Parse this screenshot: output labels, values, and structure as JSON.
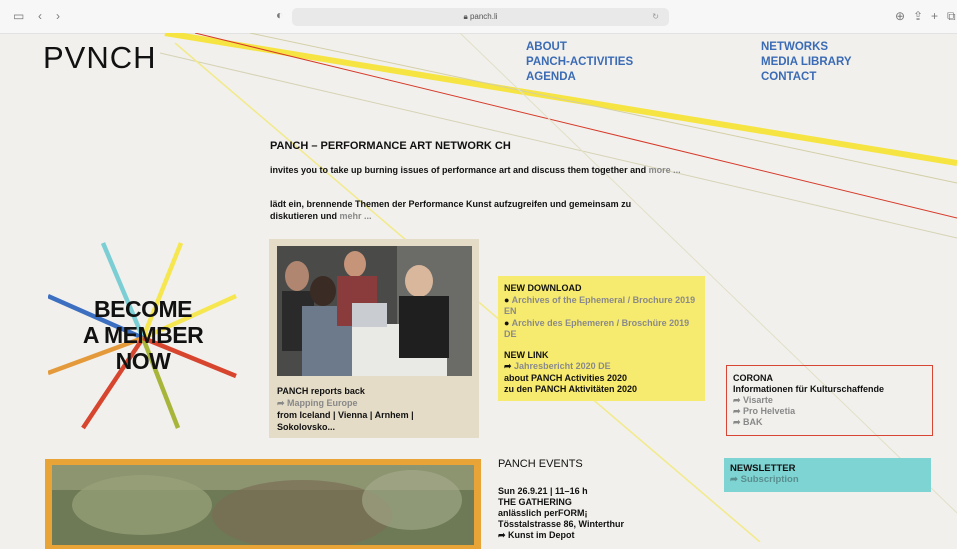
{
  "browser": {
    "url": "panch.li",
    "sidebar_icon": "sidebar-icon",
    "back": "‹",
    "forward": "›",
    "privacy_icon": "shield-icon",
    "right_icons": [
      "download-icon",
      "share-icon",
      "plus-icon",
      "tabs-icon"
    ]
  },
  "logo": "PVNCH",
  "nav": {
    "col1": [
      "ABOUT",
      "PANCH-ACTIVITIES",
      "AGENDA"
    ],
    "col2": [
      "NETWORKS",
      "MEDIA LIBRARY",
      "CONTACT"
    ]
  },
  "intro": {
    "title": "PANCH – PERFORMANCE ART NETWORK CH",
    "en_text": "invites you to take up burning issues of performance art and discuss them together and ",
    "en_more": "more ...",
    "de_text": "lädt ein, brennende Themen der Performance Kunst aufzugreifen und gemeinsam zu diskutieren und ",
    "de_more": "mehr ..."
  },
  "member": {
    "line1": "BECOME",
    "line2": "A MEMBER",
    "line3": "NOW"
  },
  "report": {
    "title": "PANCH reports back",
    "link": "Mapping Europe",
    "text": "from Iceland | Vienna | Arnhem | Sokolovsko..."
  },
  "download": {
    "title": "NEW DOWNLOAD",
    "item1": "Archives of the Ephemeral / Brochure 2019 EN",
    "item2": "Archive des Ephemeren / Broschüre 2019 DE",
    "link_title": "NEW LINK",
    "link": "Jahresbericht 2020 DE",
    "about1": "about PANCH Activities 2020",
    "about2": "zu den PANCH Aktivitäten 2020"
  },
  "corona": {
    "title": "CORONA",
    "subtitle": "Informationen für Kulturschaffende",
    "links": [
      "Visarte",
      "Pro Helvetia",
      "BAK"
    ]
  },
  "events": {
    "title": "PANCH EVENTS",
    "date": "Sun 26.9.21 | 11–16 h",
    "name": "THE GATHERING",
    "sub": "anlässlich perFORM¡",
    "address": "Tösstalstrasse 86, Winterthur",
    "link": "Kunst im Depot"
  },
  "newsletter": {
    "title": "NEWSLETTER",
    "link": "Subscription"
  },
  "colors": {
    "nav": "#3b6bb5",
    "yellow": "#f6ea6f",
    "red_border": "#d74534",
    "teal": "#7ed3d3",
    "beige": "#e4dcc7",
    "orange": "#e8a437"
  }
}
